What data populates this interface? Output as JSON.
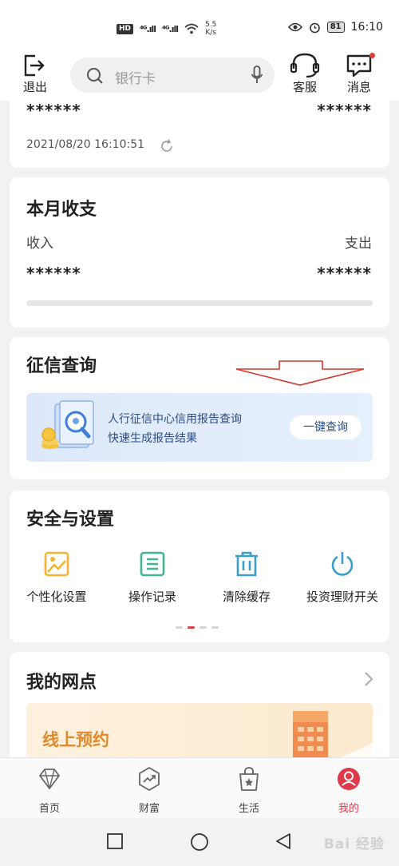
{
  "status_bar": {
    "hd": "HD",
    "sig1": "⁴ᴳ.ıll",
    "sig2": "⁴ᴳ.ıll",
    "speed_value": "5.5",
    "speed_unit": "K/s",
    "battery": "81",
    "time": "16:10"
  },
  "top_nav": {
    "logout_label": "退出",
    "search_placeholder": "银行卡",
    "service_label": "客服",
    "message_label": "消息"
  },
  "balance": {
    "amount_left": "******",
    "amount_right": "******",
    "timestamp": "2021/08/20 16:10:51"
  },
  "monthly": {
    "title": "本月收支",
    "income_label": "收入",
    "expense_label": "支出",
    "income_value": "******",
    "expense_value": "******"
  },
  "credit": {
    "title": "征信查询",
    "line1": "人行征信中心信用报告查询",
    "line2": "快速生成报告结果",
    "button_label": "一键查询"
  },
  "security": {
    "title": "安全与设置",
    "items": [
      {
        "label": "个性化设置",
        "icon": "image-icon"
      },
      {
        "label": "操作记录",
        "icon": "list-icon"
      },
      {
        "label": "清除缓存",
        "icon": "trash-icon"
      },
      {
        "label": "投资理财开关",
        "icon": "power-icon"
      }
    ],
    "page_count": 4,
    "active_page": 2
  },
  "branch": {
    "title": "我的网点",
    "banner_text": "线上预约"
  },
  "bottom_tabs": [
    {
      "label": "首页",
      "icon": "diamond-icon"
    },
    {
      "label": "财富",
      "icon": "wealth-icon"
    },
    {
      "label": "生活",
      "icon": "shopping-bag-icon"
    },
    {
      "label": "我的",
      "icon": "user-icon"
    }
  ],
  "active_tab": "我的",
  "watermark": "Bai 经验",
  "colors": {
    "accent_red": "#e0394a",
    "banner_blue_text": "#2c4c86",
    "banner_orange_text": "#e08a2c",
    "icon_yellow": "#f2b52f",
    "icon_green": "#3fb68b",
    "icon_teal": "#3a9fc8"
  }
}
